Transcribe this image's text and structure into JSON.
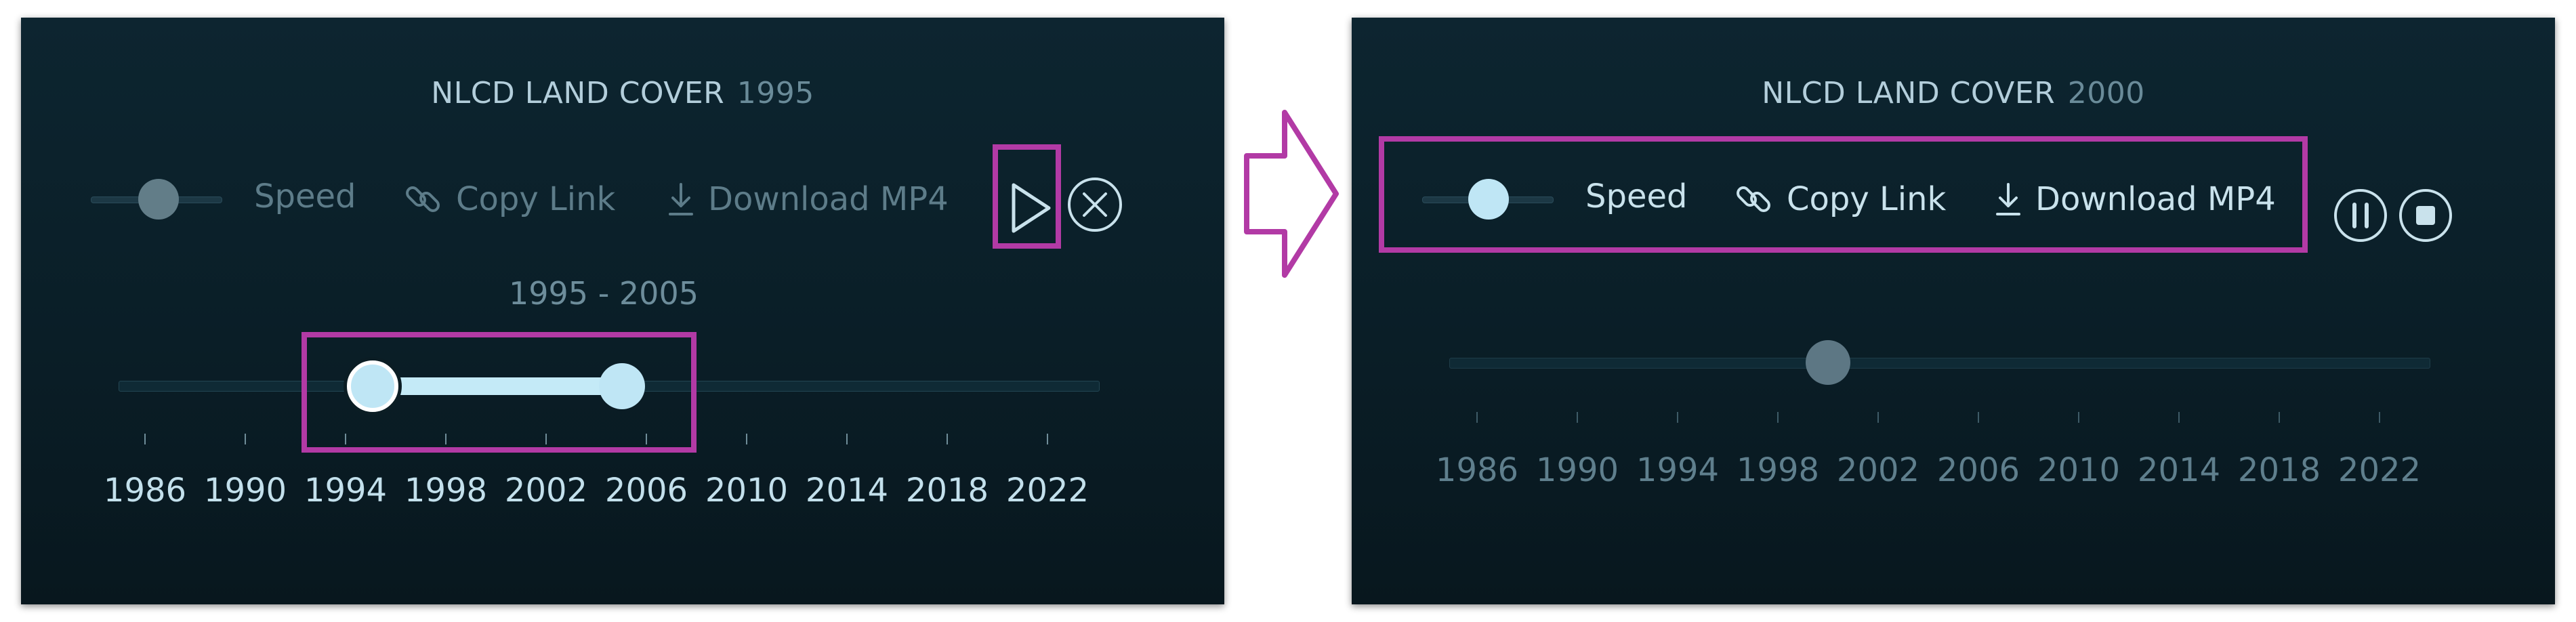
{
  "left_panel": {
    "title": "NLCD LAND COVER",
    "title_year": "1995",
    "controls": {
      "speed_label": "Speed",
      "copy_link_label": "Copy Link",
      "download_label": "Download MP4"
    },
    "range_label": "1995 - 2005",
    "range_start": 1995,
    "range_end": 2005,
    "ticks": [
      "1986",
      "1990",
      "1994",
      "1998",
      "2002",
      "2006",
      "2010",
      "2014",
      "2018",
      "2022"
    ],
    "icons": {
      "play": "play-icon",
      "close": "close-circle-icon",
      "link": "link-icon",
      "download": "download-icon"
    }
  },
  "right_panel": {
    "title": "NLCD LAND COVER",
    "title_year": "2000",
    "controls": {
      "speed_label": "Speed",
      "copy_link_label": "Copy Link",
      "download_label": "Download MP4"
    },
    "current_year": 2000,
    "ticks": [
      "1986",
      "1990",
      "1994",
      "1998",
      "2002",
      "2006",
      "2010",
      "2014",
      "2018",
      "2022"
    ],
    "icons": {
      "pause": "pause-circle-icon",
      "stop": "stop-circle-icon",
      "link": "link-icon",
      "download": "download-icon"
    }
  },
  "colors": {
    "highlight": "#b23aa5",
    "panel_bg": "#0c222c",
    "accent": "#bfe6f5",
    "text_dim": "#5d7c89",
    "text_bright": "#c9e2ec"
  }
}
